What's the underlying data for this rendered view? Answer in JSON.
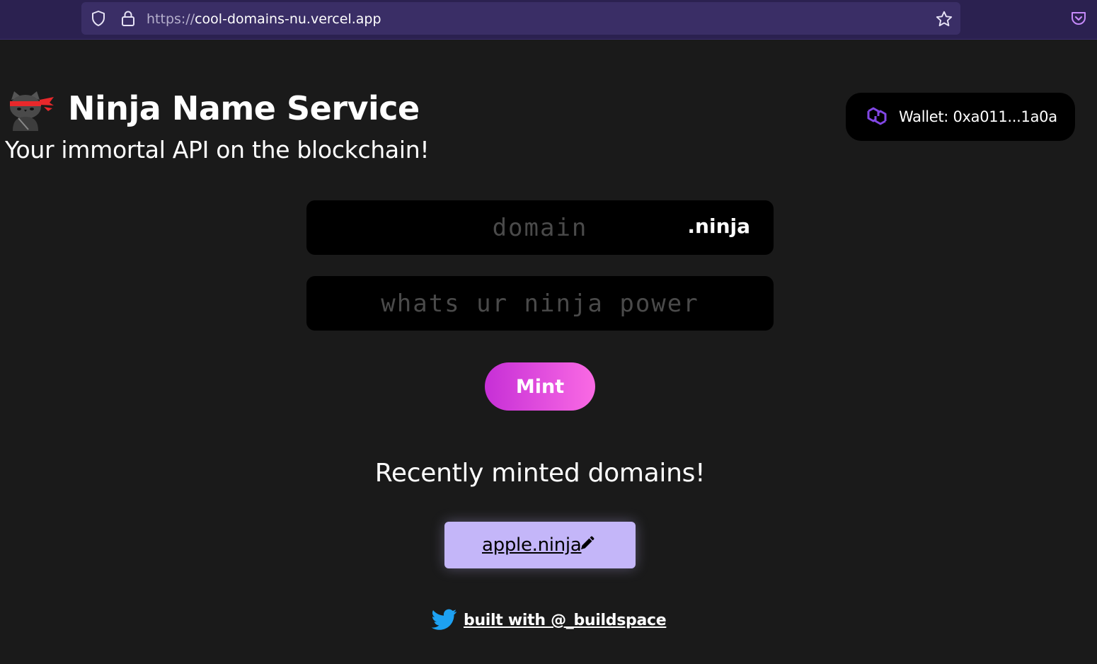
{
  "browser": {
    "url_scheme": "https://",
    "url_host": "cool-domains-nu.vercel.app"
  },
  "header": {
    "title": "Ninja Name Service",
    "subtitle": "Your immortal API on the blockchain!"
  },
  "wallet": {
    "label": "Wallet: 0xa011...1a0a",
    "icon": "polygon-icon"
  },
  "form": {
    "domain_placeholder": "domain",
    "tld": ".ninja",
    "power_placeholder": "whats ur ninja power",
    "mint_label": "Mint"
  },
  "recent": {
    "title": "Recently minted domains!",
    "items": [
      {
        "name": "apple.ninja",
        "icon": "pencil-icon"
      }
    ]
  },
  "footer": {
    "text": "built with @_buildspace",
    "icon": "twitter-icon"
  },
  "colors": {
    "background": "#1a1a1a",
    "browser_bar": "#2b2150",
    "mint_gradient_start": "#c62fd6",
    "mint_gradient_end": "#fa6ae4",
    "card": "#c4b6f9",
    "polygon": "#8247e5"
  }
}
